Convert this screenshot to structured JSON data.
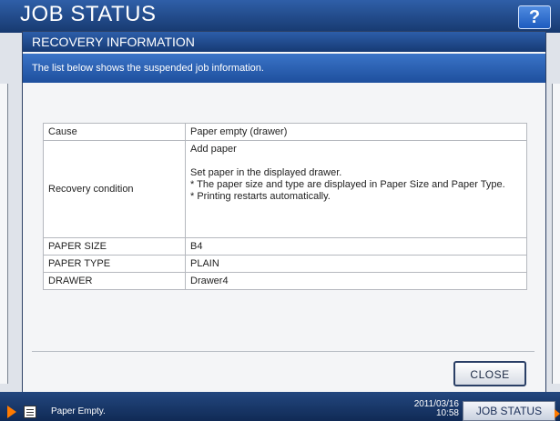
{
  "screen": {
    "title": "JOB STATUS",
    "help_label": "?"
  },
  "dialog": {
    "title": "RECOVERY INFORMATION",
    "info": "The list below shows the suspended job information.",
    "rows": [
      {
        "label": "Cause",
        "value": "Paper empty (drawer)"
      },
      {
        "label": "Recovery condition",
        "value": "Add paper\n\nSet paper in the displayed drawer.\n* The paper size and type are displayed in Paper Size and Paper Type.\n* Printing restarts automatically."
      },
      {
        "label": "PAPER SIZE",
        "value": "B4"
      },
      {
        "label": "PAPER TYPE",
        "value": "PLAIN"
      },
      {
        "label": "DRAWER",
        "value": "Drawer4"
      }
    ],
    "close_label": "CLOSE"
  },
  "status_bar": {
    "message": "Paper Empty.",
    "date": "2011/03/16",
    "time": "10:58",
    "job_status_label": "JOB STATUS"
  },
  "colors": {
    "header": "#1e4f9d",
    "accent": "#ff7a00"
  }
}
